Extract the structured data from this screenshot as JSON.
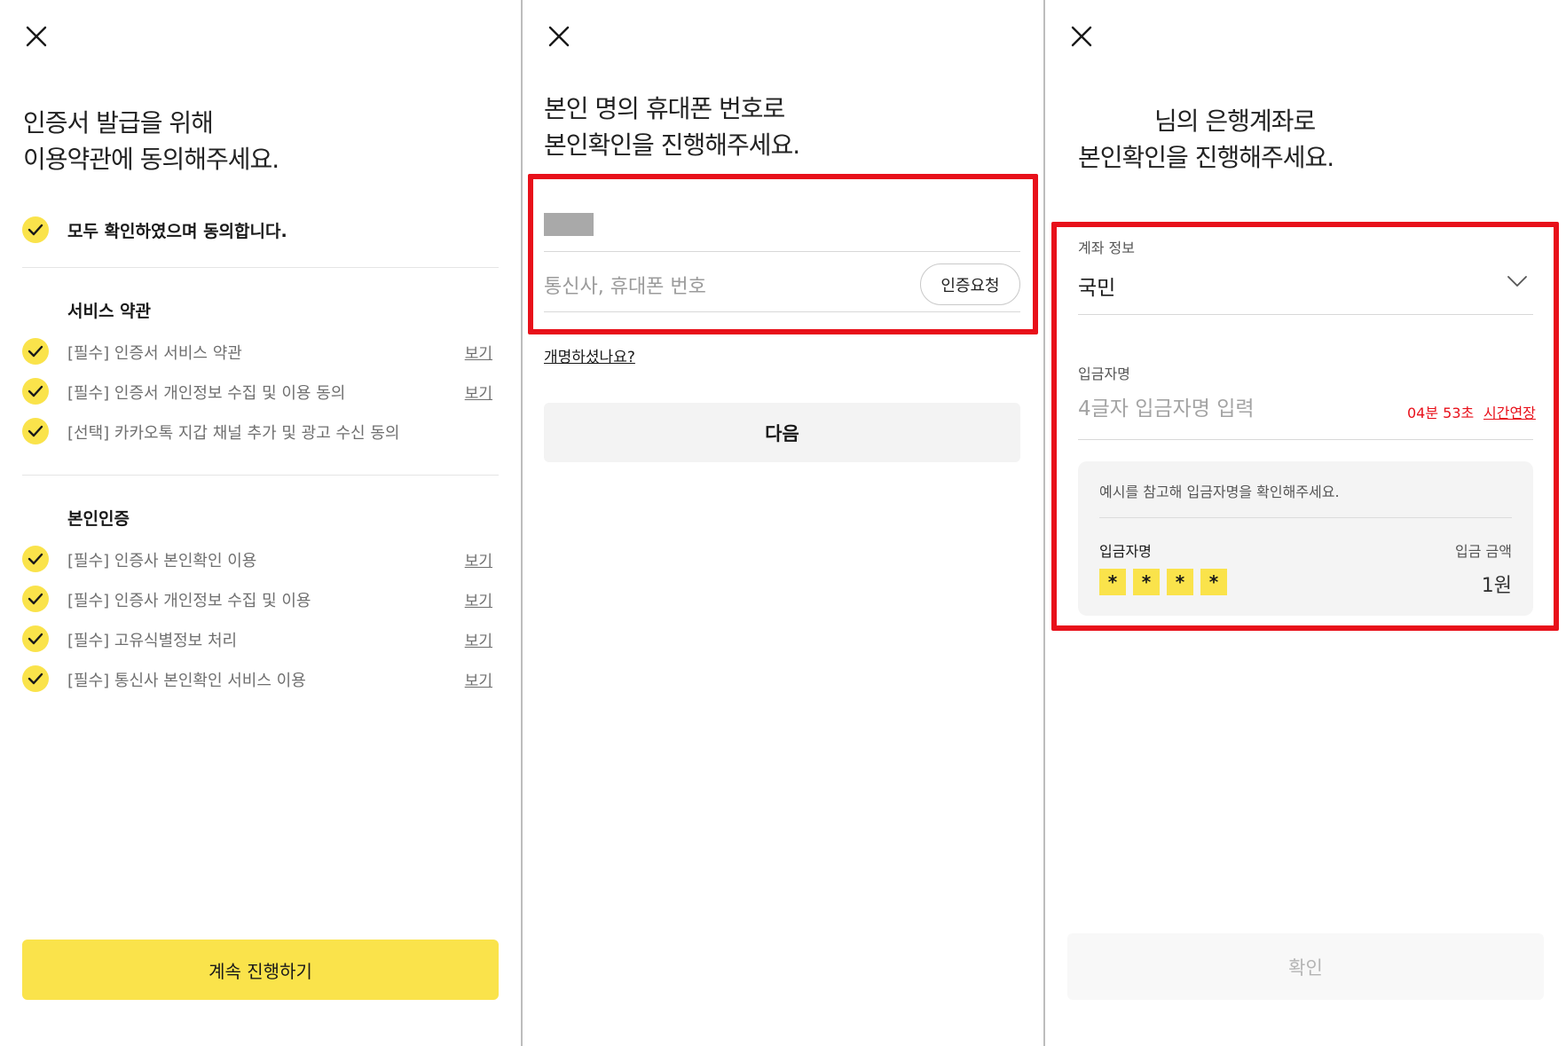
{
  "colors": {
    "accent_yellow": "#fae34b",
    "highlight_red": "#e8101a",
    "divider": "#bdbdbd"
  },
  "panel1": {
    "title_line1": "인증서 발급을 위해",
    "title_line2": "이용약관에 동의해주세요.",
    "agree_all": "모두 확인하였으며 동의합니다.",
    "section_service": "서비스 약관",
    "service_terms": [
      {
        "label": "[필수] 인증서 서비스 약관",
        "view": "보기"
      },
      {
        "label": "[필수] 인증서 개인정보 수집 및 이용 동의",
        "view": "보기"
      },
      {
        "label": "[선택] 카카오톡 지갑 채널 추가 및 광고 수신 동의",
        "view": ""
      }
    ],
    "section_identity": "본인인증",
    "identity_terms": [
      {
        "label": "[필수] 인증사 본인확인 이용",
        "view": "보기"
      },
      {
        "label": "[필수] 인증사 개인정보 수집 및 이용",
        "view": "보기"
      },
      {
        "label": "[필수] 고유식별정보 처리",
        "view": "보기"
      },
      {
        "label": "[필수] 통신사 본인확인 서비스 이용",
        "view": "보기"
      }
    ],
    "continue_label": "계속 진행하기"
  },
  "panel2": {
    "title_line1": "본인 명의 휴대폰 번호로",
    "title_line2": "본인확인을 진행해주세요.",
    "phone_placeholder": "통신사, 휴대폰 번호",
    "auth_request_label": "인증요청",
    "name_change_link": "개명하셨나요?",
    "next_label": "다음"
  },
  "panel3": {
    "title_line1": "님의 은행계좌로",
    "title_line2": "본인확인을 진행해주세요.",
    "account_info_label": "계좌 정보",
    "bank_selected": "국민",
    "depositor_label": "입금자명",
    "depositor_placeholder": "4글자 입금자명 입력",
    "timer": "04분 53초",
    "extend_label": "시간연장",
    "example_text": "예시를 참고해 입금자명을 확인해주세요.",
    "example_name_label": "입금자명",
    "example_amount_label": "입금 금액",
    "example_stars": [
      "*",
      "*",
      "*",
      "*"
    ],
    "example_amount": "1원",
    "confirm_label": "확인"
  }
}
